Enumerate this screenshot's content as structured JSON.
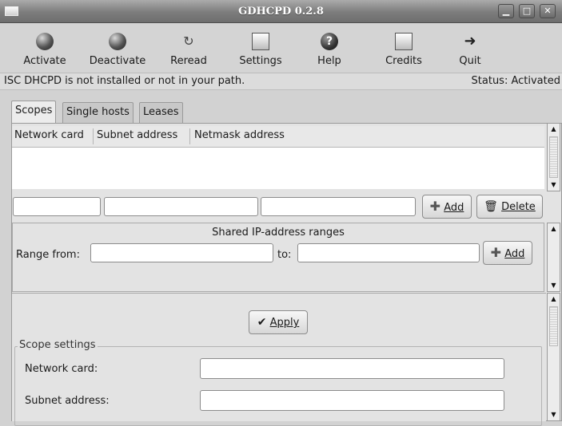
{
  "window": {
    "title": "GDHCPD 0.2.8"
  },
  "toolbar": {
    "activate": "Activate",
    "deactivate": "Deactivate",
    "reread": "Reread",
    "settings": "Settings",
    "help": "Help",
    "credits": "Credits",
    "quit": "Quit"
  },
  "status": {
    "message": "ISC DHCPD is not installed or not in your path.",
    "state": "Status: Activated"
  },
  "tabs": {
    "scopes": "Scopes",
    "single_hosts": "Single hosts",
    "leases": "Leases"
  },
  "scopes_list": {
    "columns": [
      "Network card",
      "Subnet address",
      "Netmask address"
    ],
    "rows": []
  },
  "scope_entry": {
    "network_card_value": "",
    "subnet_value": "",
    "netmask_value": "",
    "add_label": "Add",
    "delete_label": "Delete"
  },
  "shared_ranges": {
    "title": "Shared IP-address ranges",
    "range_from_label": "Range from:",
    "range_from_value": "",
    "to_label": "to:",
    "to_value": "",
    "add_label": "Add"
  },
  "apply_label": "Apply",
  "scope_settings": {
    "legend": "Scope settings",
    "network_card_label": "Network card:",
    "network_card_value": "",
    "subnet_address_label": "Subnet address:",
    "subnet_address_value": ""
  }
}
